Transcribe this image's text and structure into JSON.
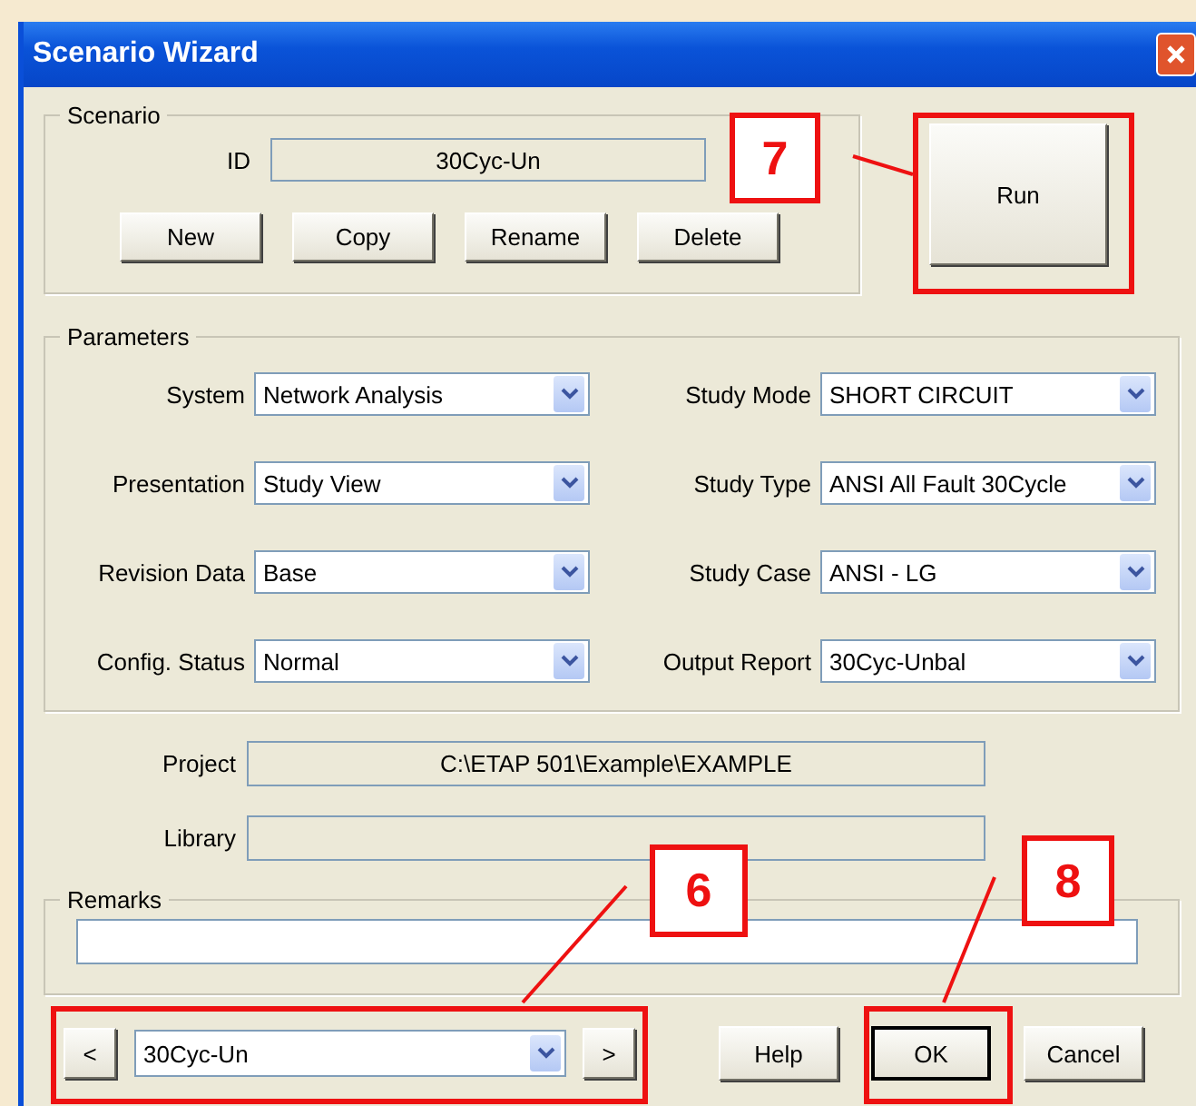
{
  "window": {
    "title": "Scenario Wizard"
  },
  "scenario": {
    "legend": "Scenario",
    "id_label": "ID",
    "id_value": "30Cyc-Un",
    "buttons": [
      "New",
      "Copy",
      "Rename",
      "Delete"
    ]
  },
  "run_button": "Run",
  "parameters": {
    "legend": "Parameters",
    "fields": [
      {
        "label": "System",
        "value": "Network Analysis"
      },
      {
        "label": "Study Mode",
        "value": "SHORT CIRCUIT"
      },
      {
        "label": "Presentation",
        "value": "Study View"
      },
      {
        "label": "Study Type",
        "value": "ANSI All Fault 30Cycle"
      },
      {
        "label": "Revision Data",
        "value": "Base"
      },
      {
        "label": "Study Case",
        "value": "ANSI - LG"
      },
      {
        "label": "Config. Status",
        "value": "Normal"
      },
      {
        "label": "Output Report",
        "value": "30Cyc-Unbal"
      }
    ]
  },
  "project": {
    "label": "Project",
    "value": "C:\\ETAP 501\\Example\\EXAMPLE"
  },
  "library": {
    "label": "Library"
  },
  "remarks": {
    "legend": "Remarks"
  },
  "navigator": {
    "prev": "<",
    "value": "30Cyc-Un",
    "next": ">"
  },
  "buttons": [
    {
      "label": "Help",
      "default": false
    },
    {
      "label": "OK",
      "default": true
    },
    {
      "label": "Cancel",
      "default": false
    }
  ],
  "callouts": [
    {
      "number": "7"
    },
    {
      "number": "6"
    },
    {
      "number": "8"
    }
  ]
}
